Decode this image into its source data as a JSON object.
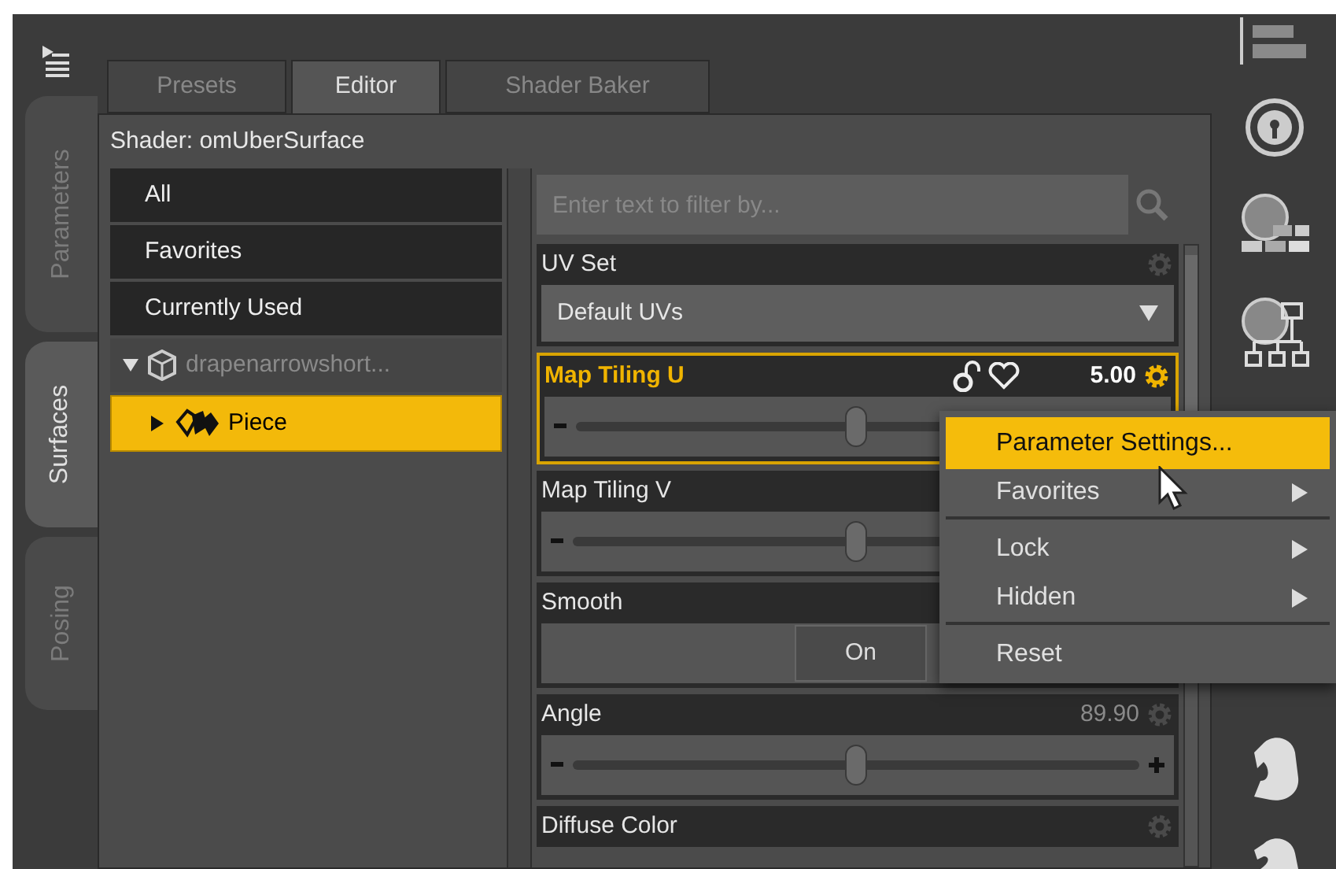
{
  "side_tabs": [
    {
      "label": "Parameters",
      "selected": false
    },
    {
      "label": "Surfaces",
      "selected": true
    },
    {
      "label": "Posing",
      "selected": false
    }
  ],
  "tabs": [
    {
      "label": "Presets",
      "selected": false
    },
    {
      "label": "Editor",
      "selected": true
    },
    {
      "label": "Shader Baker",
      "selected": false
    }
  ],
  "shader_label": "Shader: omUberSurface",
  "filters": [
    {
      "label": "All",
      "selected": false
    },
    {
      "label": "Favorites",
      "selected": false
    },
    {
      "label": "Currently Used",
      "selected": false
    }
  ],
  "tree": [
    {
      "label": "drapenarrowshort...",
      "expanded": true,
      "selected": false,
      "children": [
        {
          "label": "Piece",
          "expanded": false,
          "selected": true
        }
      ]
    }
  ],
  "filter_field": {
    "placeholder": "Enter text to filter by..."
  },
  "parameters": [
    {
      "kind": "dropdown",
      "label": "UV Set",
      "value": "Default UVs",
      "selected": false
    },
    {
      "kind": "slider",
      "label": "Map Tiling U",
      "value": "5.00",
      "level": 0.5,
      "selected": true
    },
    {
      "kind": "slider",
      "label": "Map Tiling V",
      "level": 0.5,
      "selected": false
    },
    {
      "kind": "toggle",
      "label": "Smooth",
      "value": "On",
      "selected": false
    },
    {
      "kind": "slider",
      "label": "Angle",
      "value": "89.90",
      "level": 0.5,
      "selected": false
    },
    {
      "kind": "color",
      "label": "Diffuse Color",
      "selected": false
    }
  ],
  "context_menu": [
    {
      "label": "Parameter Settings...",
      "selected": true,
      "submenu": false,
      "separator_after": false
    },
    {
      "label": "Favorites",
      "selected": false,
      "submenu": true,
      "separator_after": true
    },
    {
      "label": "Lock",
      "selected": false,
      "submenu": true,
      "separator_after": false
    },
    {
      "label": "Hidden",
      "selected": false,
      "submenu": true,
      "separator_after": true
    },
    {
      "label": "Reset",
      "selected": false,
      "submenu": false,
      "separator_after": false
    }
  ]
}
